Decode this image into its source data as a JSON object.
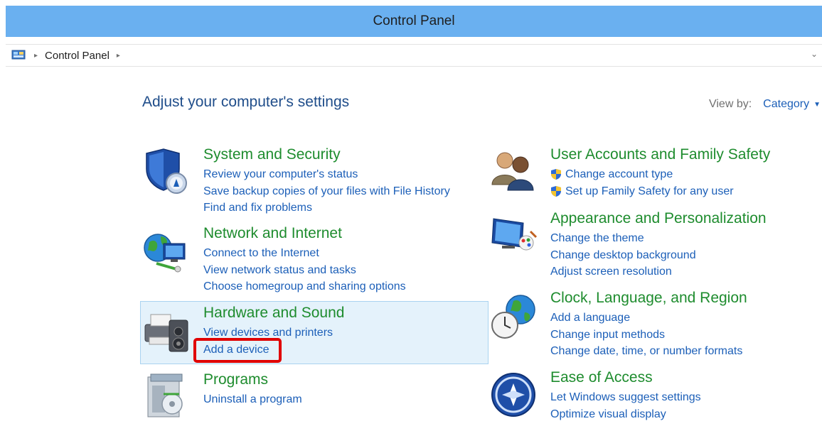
{
  "window": {
    "title": "Control Panel"
  },
  "address": {
    "crumb": "Control Panel",
    "sep1": "▸",
    "sep2": "▸",
    "dropdown": "⌄"
  },
  "header": {
    "title": "Adjust your computer's settings"
  },
  "view_by": {
    "label": "View by:",
    "value": "Category",
    "caret": "▼"
  },
  "categories": {
    "system_security": {
      "title": "System and Security",
      "links": [
        "Review your computer's status",
        "Save backup copies of your files with File History",
        "Find and fix problems"
      ]
    },
    "network": {
      "title": "Network and Internet",
      "links": [
        "Connect to the Internet",
        "View network status and tasks",
        "Choose homegroup and sharing options"
      ]
    },
    "hardware": {
      "title": "Hardware and Sound",
      "links": [
        "View devices and printers",
        "Add a device"
      ]
    },
    "programs": {
      "title": "Programs",
      "links": [
        "Uninstall a program"
      ]
    },
    "user_accounts": {
      "title": "User Accounts and Family Safety",
      "links": [
        "Change account type",
        "Set up Family Safety for any user"
      ]
    },
    "appearance": {
      "title": "Appearance and Personalization",
      "links": [
        "Change the theme",
        "Change desktop background",
        "Adjust screen resolution"
      ]
    },
    "clock": {
      "title": "Clock, Language, and Region",
      "links": [
        "Add a language",
        "Change input methods",
        "Change date, time, or number formats"
      ]
    },
    "ease": {
      "title": "Ease of Access",
      "links": [
        "Let Windows suggest settings",
        "Optimize visual display"
      ]
    }
  },
  "colors": {
    "title_bar": "#6ab0f0",
    "category_title": "#1e8c2e",
    "link": "#1c5fb8",
    "heading": "#1f4d8a",
    "highlight": "#e4f2fb",
    "annotation": "#e00000"
  }
}
